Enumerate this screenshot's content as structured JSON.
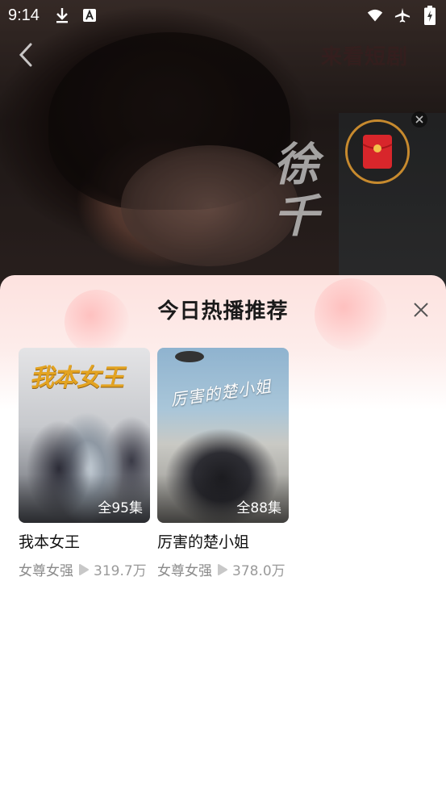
{
  "status_bar": {
    "time": "9:14"
  },
  "header": {
    "title": "来看短剧"
  },
  "overlay": {
    "calligraphy": "徐千"
  },
  "sheet": {
    "title": "今日热播推荐",
    "items": [
      {
        "name": "我本女王",
        "poster_text": "我本女王",
        "episodes": "全95集",
        "tag": "女尊女强",
        "views": "319.7万"
      },
      {
        "name": "厉害的楚小姐",
        "poster_text": "厉害的楚小姐",
        "episodes": "全88集",
        "tag": "女尊女强",
        "views": "378.0万"
      }
    ]
  },
  "colors": {
    "accent_gold": "#e3a321",
    "red_packet": "#d8262b",
    "sheet_gradient_top": "#fde2df"
  },
  "icons": [
    "download-icon",
    "text-a-icon",
    "wifi-icon",
    "airplane-icon",
    "battery-charging-icon",
    "back-arrow-icon",
    "red-packet-icon",
    "close-icon",
    "play-icon"
  ]
}
